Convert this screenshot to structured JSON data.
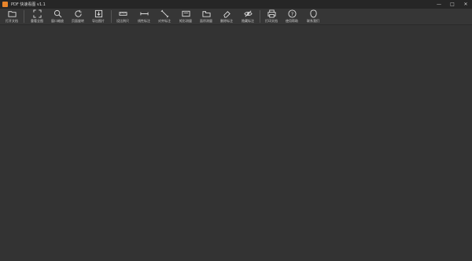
{
  "window": {
    "title": "PDF 快速看图 v1.1",
    "controls": [
      "—",
      "□",
      "✕"
    ]
  },
  "toolbar": {
    "items": [
      {
        "label": "打开文档",
        "icon": "folder-icon"
      },
      {
        "label": "重看全图",
        "icon": "fit-icon"
      },
      {
        "label": "窗口缩放",
        "icon": "zoom-icon"
      },
      {
        "label": "页面旋转",
        "icon": "rotate-icon"
      },
      {
        "label": "导出图片",
        "icon": "export-icon"
      },
      {
        "label": "设比例尺",
        "icon": "scale-icon"
      },
      {
        "label": "线性标注",
        "icon": "linear-icon"
      },
      {
        "label": "对齐标注",
        "icon": "aligned-icon"
      },
      {
        "label": "矩形测量",
        "icon": "rect-measure-icon"
      },
      {
        "label": "面积测量",
        "icon": "area-icon"
      },
      {
        "label": "删除标注",
        "icon": "eraser-icon"
      },
      {
        "label": "隐藏标注",
        "icon": "hide-icon"
      },
      {
        "label": "打印文档",
        "icon": "print-icon"
      },
      {
        "label": "使用帮助",
        "icon": "help-icon"
      },
      {
        "label": "联系我们",
        "icon": "contact-icon"
      }
    ]
  }
}
